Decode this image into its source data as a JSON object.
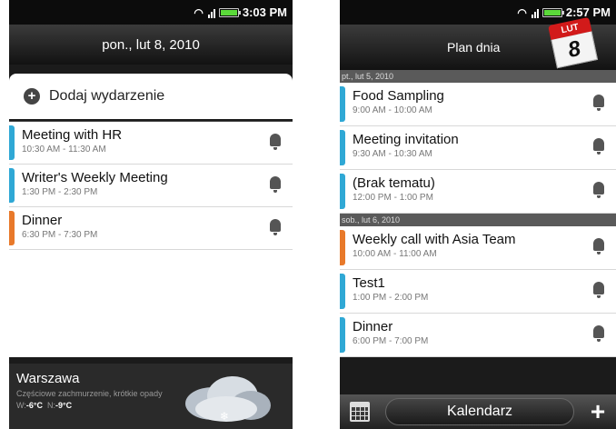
{
  "left": {
    "status_time": "3:03 PM",
    "date_header": "pon., lut 8, 2010",
    "add_event_label": "Dodaj wydarzenie",
    "events": [
      {
        "title": "Meeting with HR",
        "time": "10:30 AM - 11:30 AM",
        "color": "#2fa8d5"
      },
      {
        "title": "Writer's Weekly Meeting",
        "time": "1:30 PM - 2:30 PM",
        "color": "#2fa8d5"
      },
      {
        "title": "Dinner",
        "time": "6:30 PM - 7:30 PM",
        "color": "#e8792a"
      }
    ],
    "weather": {
      "city": "Warszawa",
      "description": "Częściowe zachmurzenie, krótkie opady",
      "high_label": "W:",
      "high": "-6°C",
      "low_label": "N:",
      "low": "-9°C",
      "icon": "cloud-snow-icon"
    }
  },
  "right": {
    "status_time": "2:57 PM",
    "header_title": "Plan dnia",
    "calendar_icon": {
      "month": "LUT",
      "day": "8"
    },
    "days": [
      {
        "label": "pt., lut 5, 2010",
        "events": [
          {
            "title": "Food Sampling",
            "time": "9:00 AM - 10:00 AM",
            "color": "#2fa8d5"
          },
          {
            "title": "Meeting invitation",
            "time": "9:30 AM - 10:30 AM",
            "color": "#2fa8d5"
          },
          {
            "title": "(Brak tematu)",
            "time": "12:00 PM - 1:00 PM",
            "color": "#2fa8d5"
          }
        ]
      },
      {
        "label": "sob., lut 6, 2010",
        "events": [
          {
            "title": "Weekly call with Asia Team",
            "time": "10:00 AM - 11:00 AM",
            "color": "#e8792a"
          },
          {
            "title": "Test1",
            "time": "1:00 PM - 2:00 PM",
            "color": "#2fa8d5"
          },
          {
            "title": "Dinner",
            "time": "6:00 PM - 7:00 PM",
            "color": "#2fa8d5"
          }
        ]
      }
    ],
    "bottom_label": "Kalendarz",
    "add_icon": "+"
  }
}
